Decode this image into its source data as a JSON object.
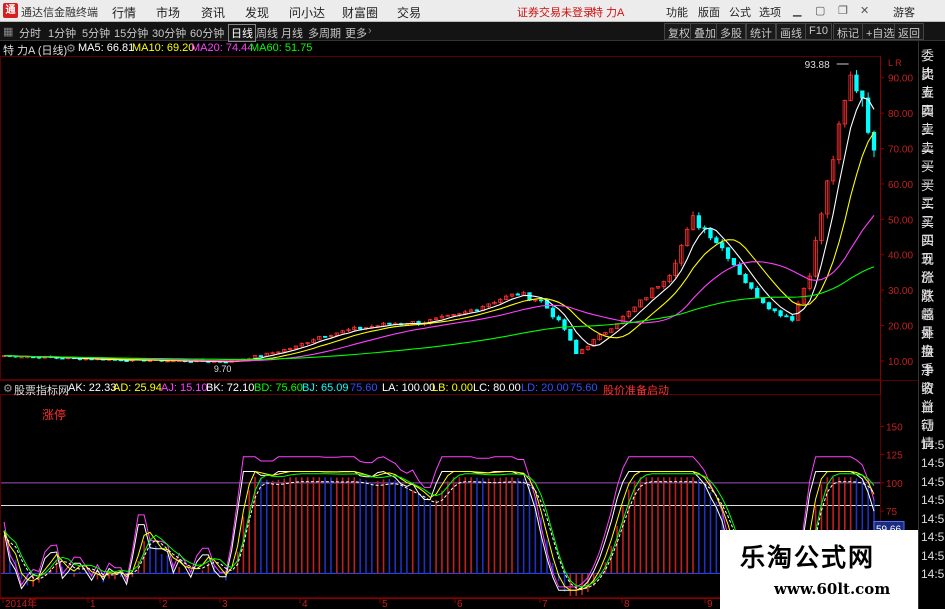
{
  "title_bar": {
    "app_name": "通达信金融终端",
    "menus": [
      "行情",
      "市场",
      "资讯",
      "发现",
      "问小达",
      "财富圈",
      "交易"
    ],
    "notice": "证券交易未登录",
    "stock_name": "特 力A",
    "right_items": [
      "功能",
      "版面",
      "公式",
      "选项"
    ],
    "user": "游客"
  },
  "toolbar": {
    "periods": [
      "分时",
      "1分钟",
      "5分钟",
      "15分钟",
      "30分钟",
      "60分钟",
      "日线",
      "周线",
      "月线",
      "多周期",
      "更多"
    ],
    "selected_period": "日线",
    "right_buttons": [
      "复权",
      "叠加",
      "多股",
      "统计",
      "画线",
      "F10",
      "标记",
      "+自选",
      "返回"
    ]
  },
  "main_chart": {
    "stock_label": "特 力A (日线)",
    "ma": [
      {
        "label": "MA5: 66.81",
        "color": "#ffffff"
      },
      {
        "label": "MA10: 69.20",
        "color": "#ffff00"
      },
      {
        "label": "MA20: 74.44",
        "color": "#ff40ff"
      },
      {
        "label": "MA60: 51.75",
        "color": "#00ff00"
      }
    ],
    "high_label": "93.88",
    "low_label": "9.70",
    "y_ticks": [
      "90.00",
      "80.00",
      "70.00",
      "60.00",
      "50.00",
      "40.00",
      "30.00",
      "20.00",
      "10.00"
    ],
    "corner_label": "L\nR"
  },
  "indicator": {
    "name": "股票指标网",
    "items": [
      {
        "label": "AK: 22.33",
        "color": "#ffffff"
      },
      {
        "label": "AD: 25.94",
        "color": "#ffff00"
      },
      {
        "label": "AJ: 15.10",
        "color": "#ff40ff"
      },
      {
        "label": "BK: 72.10",
        "color": "#ffffff"
      },
      {
        "label": "BD: 75.60",
        "color": "#00ff00"
      },
      {
        "label": "BJ: 65.09",
        "color": "#00ffff"
      },
      {
        "label": "75.60",
        "color": "#3050ff"
      },
      {
        "label": "LA: 100.00",
        "color": "#ffffff"
      },
      {
        "label": "LB: 0.00",
        "color": "#ffff00"
      },
      {
        "label": "LC: 80.00",
        "color": "#ffffff"
      },
      {
        "label": "LD: 20.00",
        "color": "#3050ff"
      },
      {
        "label": "75.60",
        "color": "#3050ff"
      },
      {
        "label": "股价准备启动",
        "color": "#ff3030"
      }
    ],
    "annotation": "涨停",
    "y_ticks": [
      "150",
      "125",
      "100",
      "75",
      "50",
      "25"
    ],
    "current_value": "59.66"
  },
  "x_axis": {
    "labels": [
      "2014年",
      "1",
      "2",
      "3",
      "4",
      "5",
      "6",
      "7",
      "8",
      "9"
    ]
  },
  "right_sidebar": {
    "items": [
      "委比",
      "卖五",
      "卖四",
      "卖三",
      "卖二",
      "卖一",
      "买一",
      "买二",
      "买三",
      "买四",
      "买五",
      "现价",
      "涨跌",
      "涨幅",
      "总量",
      "外盘",
      "换手",
      "净资",
      "收益",
      "自动",
      "行情",
      "14:5",
      "14:5",
      "14:5",
      "14:5",
      "14:5",
      "14:5",
      "14:5",
      "14:5"
    ]
  },
  "watermark": {
    "title": "乐淘公式网",
    "url": "www.60lt.com"
  },
  "colors": {
    "up": "#ff3030",
    "down": "#00ffff",
    "ma5": "#ffffff",
    "ma10": "#ffff00",
    "ma20": "#ff40ff",
    "ma60": "#00ff00"
  }
}
